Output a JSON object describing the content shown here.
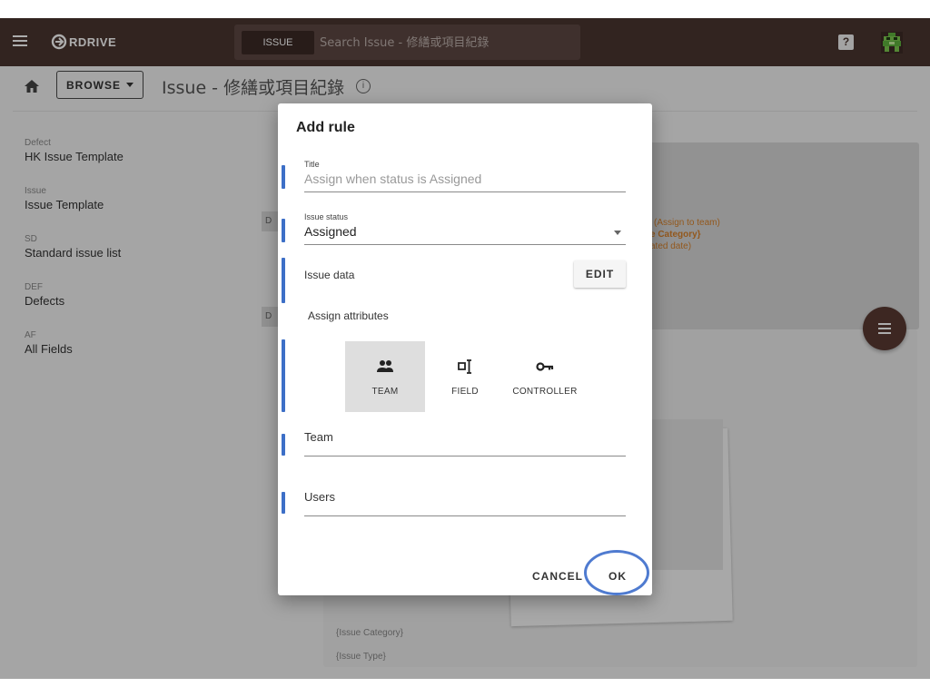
{
  "topbar": {
    "logo_text": "RDRIVE",
    "search_tag": "ISSUE",
    "search_placeholder": "Search Issue - 修繕或項目紀錄",
    "help_label": "?"
  },
  "header": {
    "browse_label": "BROWSE",
    "page_title": "Issue - 修繕或項目紀錄"
  },
  "sidebar": {
    "items": [
      {
        "code": "Defect",
        "name": "HK Issue Template"
      },
      {
        "code": "Issue",
        "name": "Issue Template"
      },
      {
        "code": "SD",
        "name": "Standard issue list"
      },
      {
        "code": "DEF",
        "name": "Defects"
      },
      {
        "code": "AF",
        "name": "All Fields"
      }
    ],
    "tag_letter": "D"
  },
  "background": {
    "orange_line1": "(Assign to team)",
    "orange_line2": "e Category}",
    "orange_line3": "ated date)",
    "label_category": "{Issue Category}",
    "label_type": "{Issue Type}"
  },
  "dialog": {
    "title": "Add rule",
    "title_field": {
      "label": "Title",
      "value": "Assign when status is Assigned"
    },
    "status_field": {
      "label": "Issue status",
      "value": "Assigned"
    },
    "issue_data_label": "Issue data",
    "edit_label": "EDIT",
    "assign_attributes_label": "Assign attributes",
    "attributes": [
      {
        "label": "TEAM",
        "icon": "team-icon",
        "active": true
      },
      {
        "label": "FIELD",
        "icon": "field-icon",
        "active": false
      },
      {
        "label": "CONTROLLER",
        "icon": "key-icon",
        "active": false
      }
    ],
    "team_label": "Team",
    "users_label": "Users",
    "cancel_label": "CANCEL",
    "ok_label": "OK"
  },
  "colors": {
    "topbar": "#4a3530",
    "accent_blue": "#3d6fc7",
    "orange_text": "#d9822b",
    "fab": "#5a3a33"
  }
}
